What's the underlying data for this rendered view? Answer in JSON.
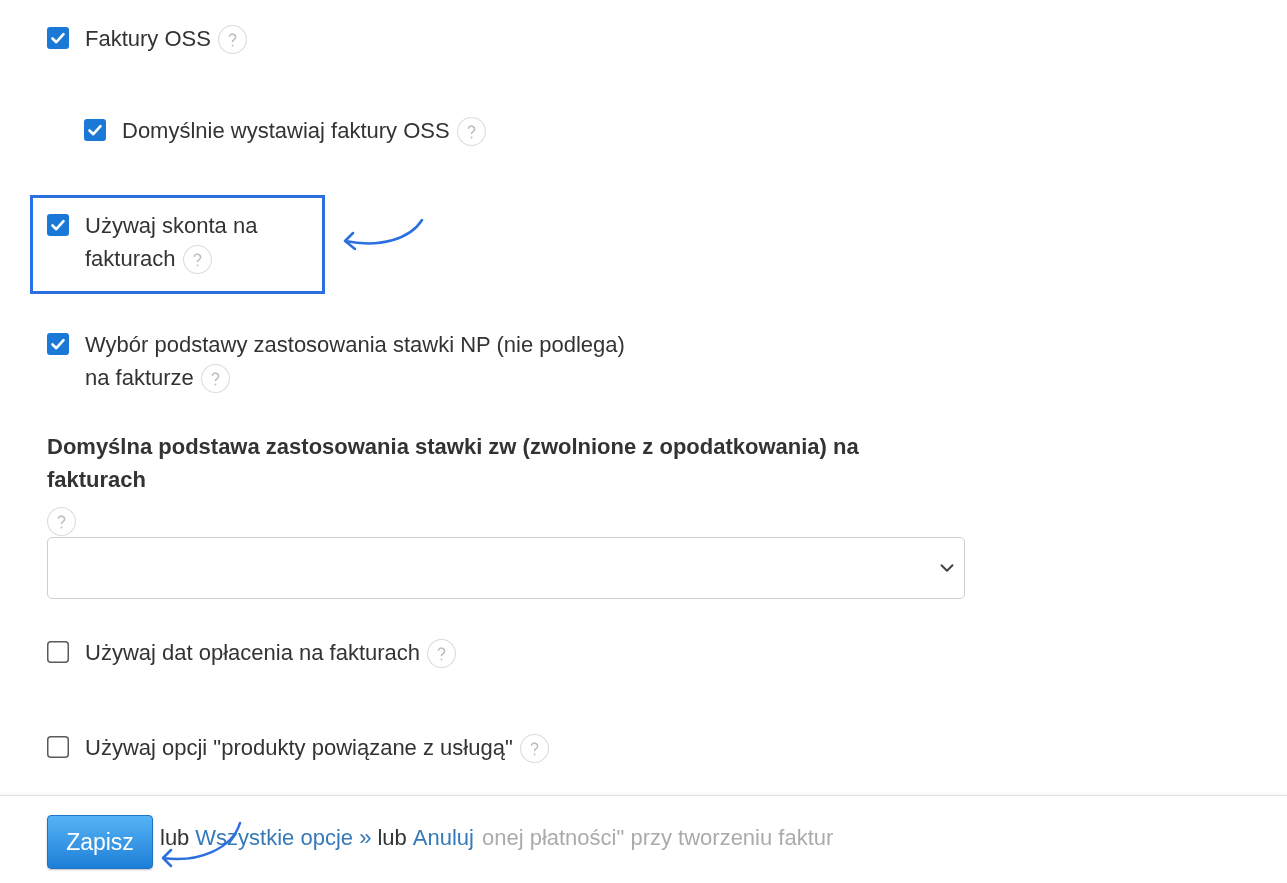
{
  "options": [
    {
      "kind": "checkbox",
      "label": "Faktury OSS",
      "checked": true,
      "children": [
        {
          "kind": "checkbox",
          "label": "Domyślnie wystawiaj faktury OSS",
          "checked": true
        }
      ]
    },
    {
      "kind": "checkbox",
      "label": "Używaj skonta na fakturach",
      "checked": true,
      "highlighted": true
    },
    {
      "kind": "checkbox",
      "label": "Wybór podstawy zastosowania stawki NP (nie podlega) na fakturze",
      "checked": true
    },
    {
      "kind": "select",
      "label": "Domyślna podstawa zastosowania stawki zw (zwolnione z opodatkowania) na fakturach"
    },
    {
      "kind": "checkbox",
      "label": "Używaj dat opłacenia na fakturach",
      "checked": false
    },
    {
      "kind": "checkbox",
      "label": "Używaj opcji \"produkty powiązane z usługą\"",
      "checked": false
    }
  ],
  "footer": {
    "save_button": "Zapisz",
    "pointer_arrow": true,
    "links": [
      {
        "kind": "text",
        "text": "lub"
      },
      {
        "kind": "link",
        "text": "Wszystkie opcje »"
      },
      {
        "kind": "text",
        "text": "lub"
      },
      {
        "kind": "link",
        "text": "Anuluj"
      }
    ],
    "covered_text": "onej płatności\" przy tworzeniu faktur"
  }
}
